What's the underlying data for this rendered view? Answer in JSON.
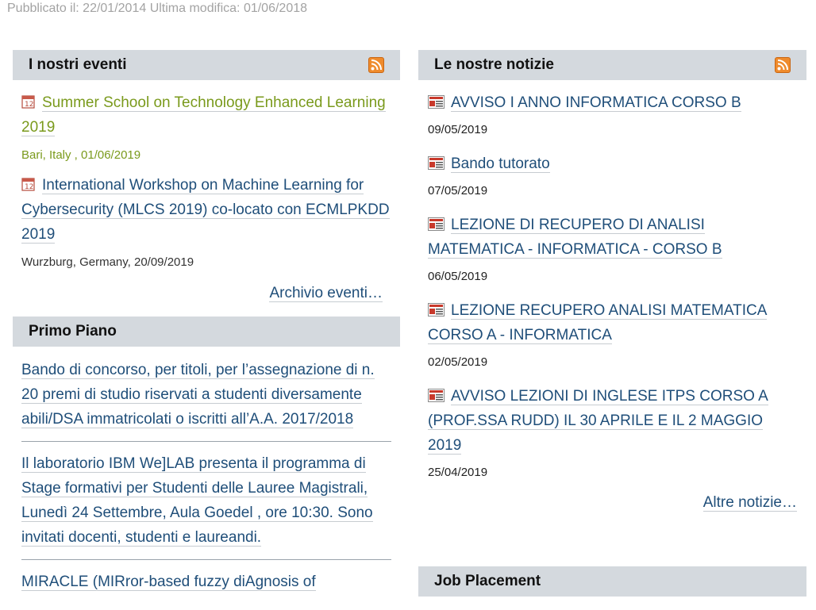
{
  "pubinfo": "Pubblicato il: 22/01/2014  Ultima modifica: 01/06/2018",
  "events": {
    "title": "I nostri eventi",
    "rss_icon": "rss-icon",
    "items": [
      {
        "title": "Summer School on Technology Enhanced Learning 2019",
        "meta": "Bari, Italy , 01/06/2019"
      },
      {
        "title": "International Workshop on Machine Learning for Cybersecurity (MLCS 2019) co-locato con ECMLPKDD 2019",
        "meta": "Wurzburg, Germany, 20/09/2019"
      }
    ],
    "archive_label": "Archivio eventi…"
  },
  "primo": {
    "title": "Primo Piano",
    "items": [
      {
        "text": "Bando di concorso, per titoli, per l’assegnazione di n. 20 premi di studio riservati a studenti diversamente abili/DSA immatricolati o iscritti all’A.A. 2017/2018"
      },
      {
        "text": "Il laboratorio IBM We]LAB presenta il programma di Stage formativi per Studenti delle Lauree Magistrali, Lunedì 24 Settembre,  Aula Goedel , ore 10:30. Sono invitati docenti, studenti e laureandi."
      },
      {
        "text": "MIRACLE (MIRror-based fuzzy diAgnosis of"
      }
    ]
  },
  "news": {
    "title": "Le nostre notizie",
    "rss_icon": "rss-icon",
    "items": [
      {
        "title": "AVVISO I ANNO INFORMATICA CORSO B",
        "date": "09/05/2019"
      },
      {
        "title": "Bando tutorato",
        "date": "07/05/2019"
      },
      {
        "title": "LEZIONE DI RECUPERO DI ANALISI MATEMATICA - INFORMATICA - CORSO B",
        "date": "06/05/2019"
      },
      {
        "title": "LEZIONE RECUPERO ANALISI MATEMATICA CORSO A - INFORMATICA",
        "date": "02/05/2019"
      },
      {
        "title": "AVVISO LEZIONI DI INGLESE ITPS CORSO A (PROF.SSA RUDD) IL 30 APRILE E IL 2 MAGGIO 2019",
        "date": "25/04/2019"
      }
    ],
    "more_label": "Altre notizie…"
  },
  "job": {
    "title": "Job Placement"
  },
  "colors": {
    "header_bg": "#d4d9de",
    "link": "#1f4e79",
    "event_link": "#7a9a1c",
    "rss": "#ef8b2c"
  }
}
